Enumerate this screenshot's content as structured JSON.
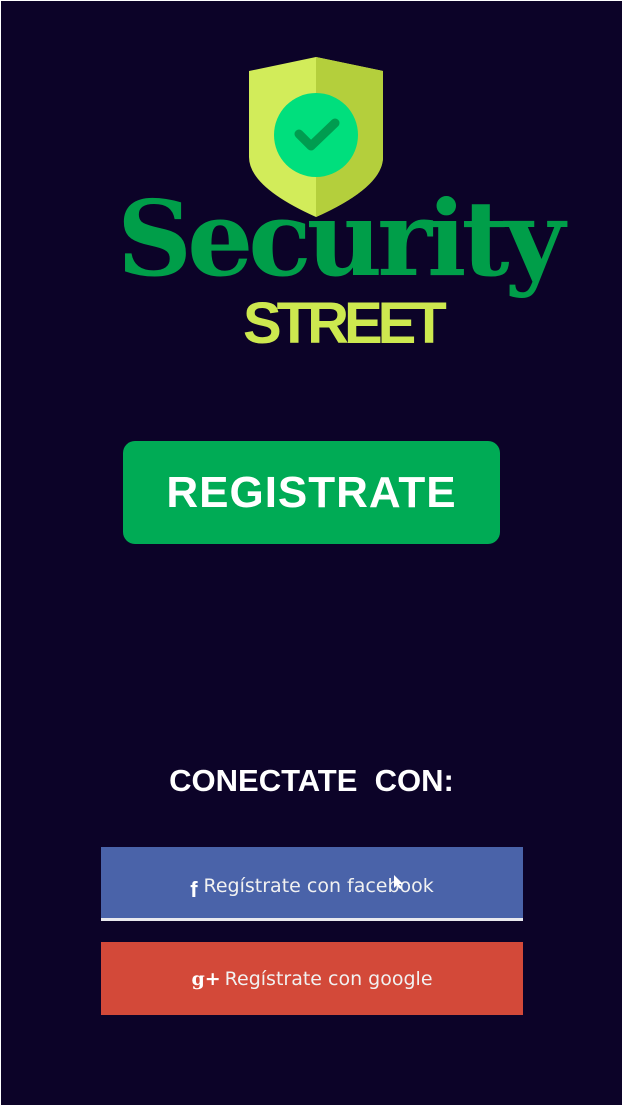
{
  "logo": {
    "icon": "shield-check-icon",
    "line1": "Security",
    "line2": "STREET",
    "colors": {
      "shield": "#d2ec5a",
      "shield_shadow": "#b4cf3c",
      "badge": "#00df7d",
      "check": "#009c50",
      "wordmark_line1": "#009e49",
      "wordmark_line2": "#cde84f"
    }
  },
  "register": {
    "label": "REGISTRATE",
    "color": "#00ab55"
  },
  "connect": {
    "heading": "CONECTATE  CON:"
  },
  "social": {
    "facebook": {
      "icon": "facebook-icon",
      "icon_glyph": "f",
      "label": "Regístrate con facebook",
      "color": "#4a63a9"
    },
    "google": {
      "icon": "google-plus-icon",
      "icon_glyph": "g+",
      "label": "Regístrate con google",
      "color": "#d34939"
    }
  },
  "theme": {
    "background": "#0c0328",
    "text": "#ffffff"
  }
}
